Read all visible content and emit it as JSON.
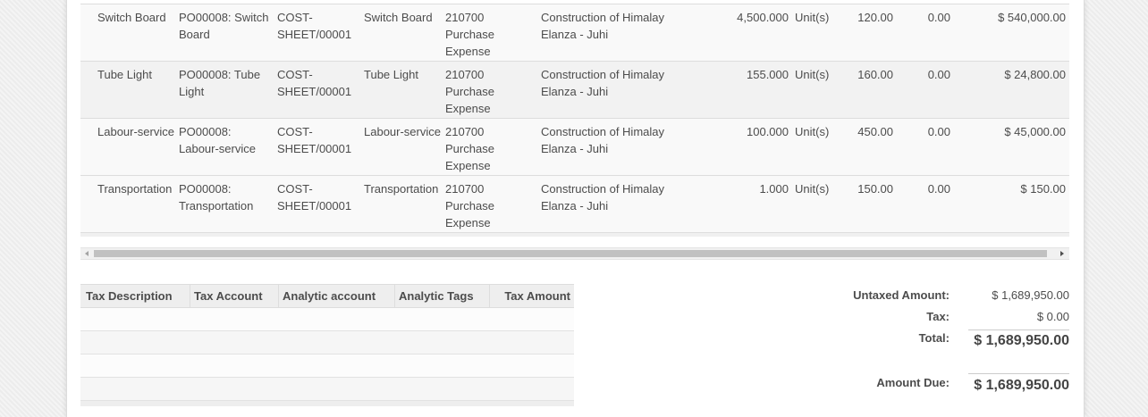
{
  "order_lines": [
    {
      "product": "Switch Board",
      "description": "PO00008: Switch Board",
      "cost_sheet": "COST-SHEET/00001",
      "item": "Switch Board",
      "account": "210700 Purchase Expense",
      "analytic_account": "Construction of Himalay Elanza - Juhi",
      "quantity": "4,500.000",
      "uom": "Unit(s)",
      "unit_price": "120.00",
      "discount": "0.00",
      "subtotal": "$ 540,000.00"
    },
    {
      "product": "Tube Light",
      "description": "PO00008: Tube Light",
      "cost_sheet": "COST-SHEET/00001",
      "item": "Tube Light",
      "account": "210700 Purchase Expense",
      "analytic_account": "Construction of Himalay Elanza - Juhi",
      "quantity": "155.000",
      "uom": "Unit(s)",
      "unit_price": "160.00",
      "discount": "0.00",
      "subtotal": "$ 24,800.00"
    },
    {
      "product": "Labour-service",
      "description": "PO00008: Labour-service",
      "cost_sheet": "COST-SHEET/00001",
      "item": "Labour-service",
      "account": "210700 Purchase Expense",
      "analytic_account": "Construction of Himalay Elanza - Juhi",
      "quantity": "100.000",
      "uom": "Unit(s)",
      "unit_price": "450.00",
      "discount": "0.00",
      "subtotal": "$ 45,000.00"
    },
    {
      "product": "Transportation",
      "description": "PO00008: Transportation",
      "cost_sheet": "COST-SHEET/00001",
      "item": "Transportation",
      "account": "210700 Purchase Expense",
      "analytic_account": "Construction of Himalay Elanza - Juhi",
      "quantity": "1.000",
      "uom": "Unit(s)",
      "unit_price": "150.00",
      "discount": "0.00",
      "subtotal": "$ 150.00"
    }
  ],
  "tax_table": {
    "headers": [
      "Tax Description",
      "Tax Account",
      "Analytic account",
      "Analytic Tags",
      "Tax Amount"
    ]
  },
  "totals": {
    "untaxed_label": "Untaxed Amount:",
    "untaxed_value": "$ 1,689,950.00",
    "tax_label": "Tax:",
    "tax_value": "$ 0.00",
    "total_label": "Total:",
    "total_value": "$ 1,689,950.00",
    "amount_due_label": "Amount Due:",
    "amount_due_value": "$ 1,689,950.00"
  },
  "icons": {
    "scroll_left": "scroll-left-arrow-icon",
    "scroll_right": "scroll-right-arrow-icon"
  }
}
